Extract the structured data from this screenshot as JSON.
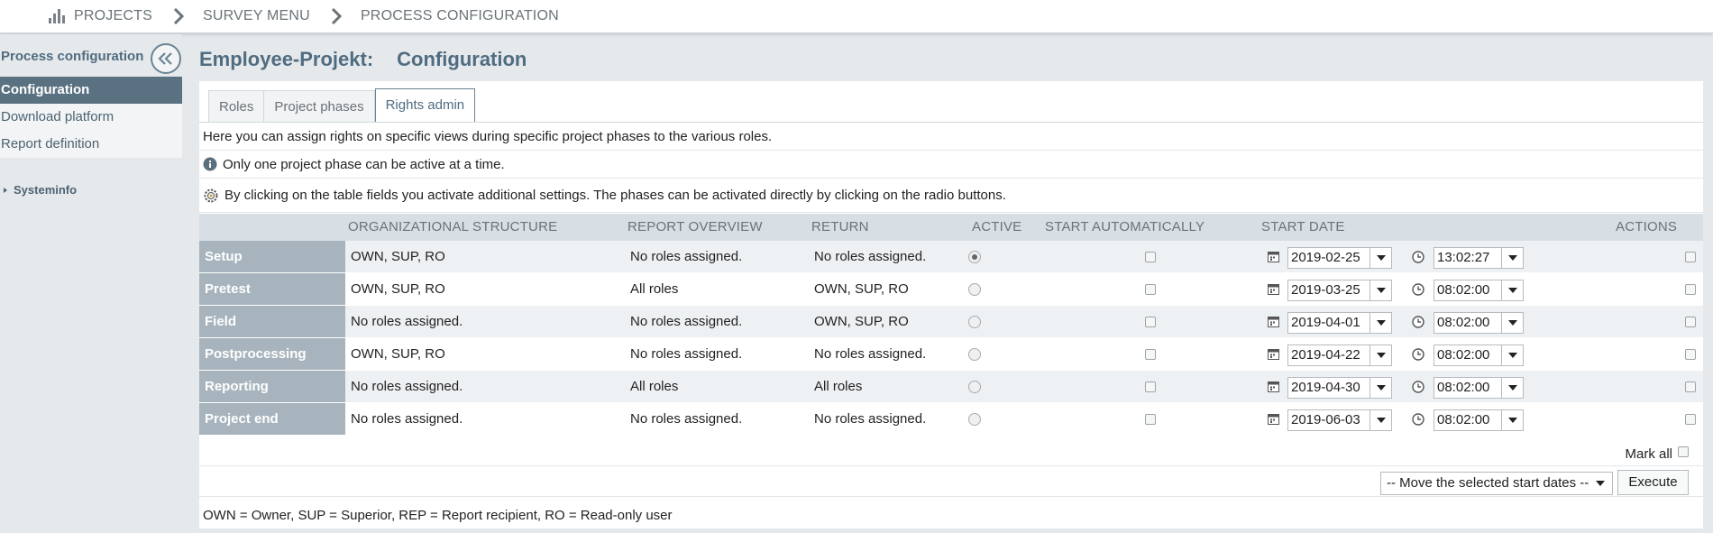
{
  "breadcrumb": {
    "items": [
      "PROJECTS",
      "SURVEY MENU",
      "PROCESS CONFIGURATION"
    ]
  },
  "sidebar": {
    "title": "Process configuration",
    "items": [
      {
        "label": "Configuration",
        "active": true
      },
      {
        "label": "Download platform",
        "active": false
      },
      {
        "label": "Report definition",
        "active": false
      }
    ],
    "systeminfo": "Systeminfo"
  },
  "page": {
    "project": "Employee-Projekt:",
    "section": "Configuration"
  },
  "tabs": [
    "Roles",
    "Project phases",
    "Rights admin"
  ],
  "info": {
    "line1": "Here you can assign rights on specific views during specific project phases to the various roles.",
    "line2": "Only one project phase can be active at a time.",
    "line3": "By clicking on the table fields you activate additional settings. The phases can be activated directly by clicking on the radio buttons."
  },
  "table": {
    "headers": {
      "org": "ORGANIZATIONAL STRUCTURE",
      "overview": "REPORT OVERVIEW",
      "ret": "RETURN",
      "active": "ACTIVE",
      "auto": "START AUTOMATICALLY",
      "date": "START DATE",
      "actions": "ACTIONS"
    },
    "rows": [
      {
        "phase": "Setup",
        "org": "OWN, SUP, RO",
        "overview": "No roles assigned.",
        "ret": "No roles assigned.",
        "active": true,
        "date": "2019-02-25",
        "time": "13:02:27"
      },
      {
        "phase": "Pretest",
        "org": "OWN, SUP, RO",
        "overview": "All roles",
        "ret": "OWN, SUP, RO",
        "active": false,
        "date": "2019-03-25",
        "time": "08:02:00"
      },
      {
        "phase": "Field",
        "org": "No roles assigned.",
        "overview": "No roles assigned.",
        "ret": "OWN, SUP, RO",
        "active": false,
        "date": "2019-04-01",
        "time": "08:02:00"
      },
      {
        "phase": "Postprocessing",
        "org": "OWN, SUP, RO",
        "overview": "No roles assigned.",
        "ret": "No roles assigned.",
        "active": false,
        "date": "2019-04-22",
        "time": "08:02:00"
      },
      {
        "phase": "Reporting",
        "org": "No roles assigned.",
        "overview": "All roles",
        "ret": "All roles",
        "active": false,
        "date": "2019-04-30",
        "time": "08:02:00"
      },
      {
        "phase": "Project end",
        "org": "No roles assigned.",
        "overview": "No roles assigned.",
        "ret": "No roles assigned.",
        "active": false,
        "date": "2019-06-03",
        "time": "08:02:00"
      }
    ]
  },
  "mark_all": "Mark all",
  "move_select": "-- Move the selected start dates --",
  "execute": "Execute",
  "legend": "OWN = Owner, SUP = Superior, REP = Report recipient, RO = Read-only user",
  "colors": {
    "accent": "#4f6c80",
    "sidebar_active": "#5a7181",
    "phase_cell": "#a7b4bd",
    "header_row": "#d8dfe4"
  }
}
